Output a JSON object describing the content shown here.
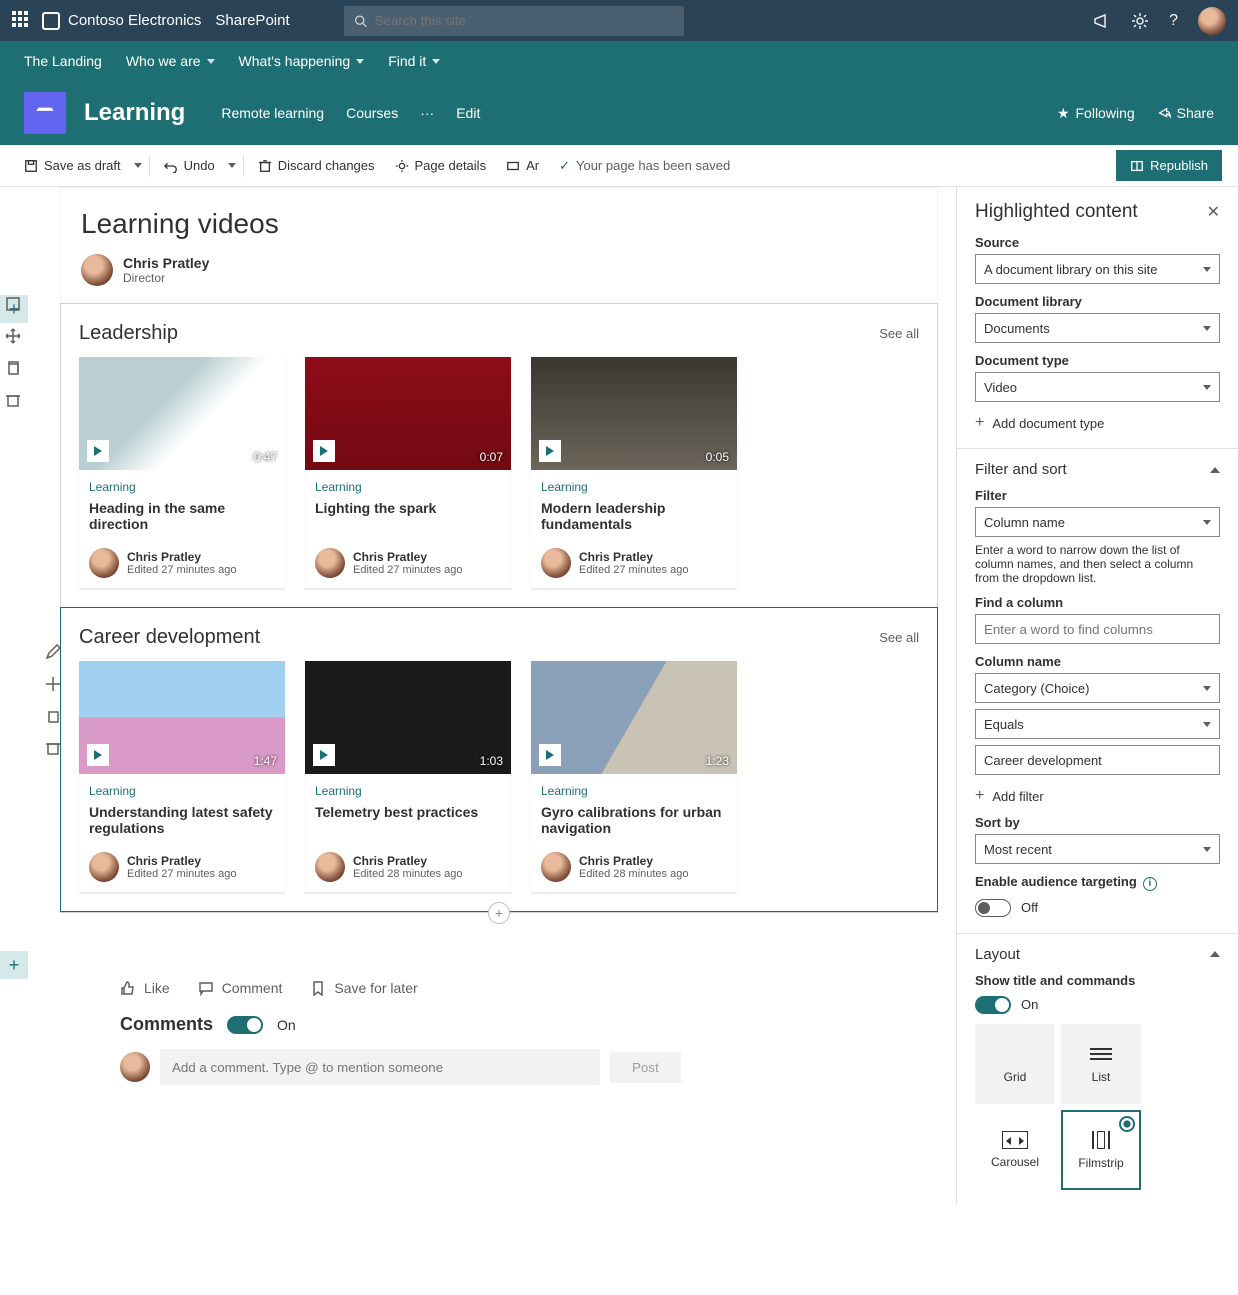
{
  "topbar": {
    "brand": "Contoso Electronics",
    "app": "SharePoint",
    "search_placeholder": "Search this site"
  },
  "sitenav": {
    "items": [
      "The Landing",
      "Who we are",
      "What's happening",
      "Find it"
    ],
    "has_dropdown": [
      false,
      true,
      true,
      true
    ]
  },
  "site": {
    "name": "Learning",
    "tabs": [
      "Remote learning",
      "Courses",
      "···",
      "Edit"
    ],
    "following": "Following",
    "share": "Share"
  },
  "cmdbar": {
    "save": "Save as draft",
    "undo": "Undo",
    "discard": "Discard changes",
    "details": "Page details",
    "ar": "Ar",
    "saved": "Your page has been saved",
    "republish": "Republish"
  },
  "page": {
    "title": "Learning videos",
    "author": "Chris Pratley",
    "role": "Director"
  },
  "sections": [
    {
      "title": "Leadership",
      "seeall": "See all",
      "cards": [
        {
          "duration": "0:47",
          "pill": "Learning",
          "title": "Heading in the same direction",
          "author": "Chris Pratley",
          "edited": "Edited 27 minutes ago",
          "thumbclass": "thumb1"
        },
        {
          "duration": "0:07",
          "pill": "Learning",
          "title": "Lighting the spark",
          "author": "Chris Pratley",
          "edited": "Edited 27 minutes ago",
          "thumbclass": "thumb2"
        },
        {
          "duration": "0:05",
          "pill": "Learning",
          "title": "Modern leadership fundamentals",
          "author": "Chris Pratley",
          "edited": "Edited 27 minutes ago",
          "thumbclass": "thumb3"
        }
      ]
    },
    {
      "title": "Career development",
      "seeall": "See all",
      "cards": [
        {
          "duration": "1:47",
          "pill": "Learning",
          "title": "Understanding latest safety regulations",
          "author": "Chris Pratley",
          "edited": "Edited 27 minutes ago",
          "thumbclass": "thumb4"
        },
        {
          "duration": "1:03",
          "pill": "Learning",
          "title": "Telemetry best practices",
          "author": "Chris Pratley",
          "edited": "Edited 28 minutes ago",
          "thumbclass": "thumb5"
        },
        {
          "duration": "1:23",
          "pill": "Learning",
          "title": "Gyro calibrations for urban navigation",
          "author": "Chris Pratley",
          "edited": "Edited 28 minutes ago",
          "thumbclass": "thumb6"
        }
      ]
    }
  ],
  "social": {
    "like": "Like",
    "comment": "Comment",
    "save": "Save for later"
  },
  "comments": {
    "title": "Comments",
    "state": "On",
    "placeholder": "Add a comment. Type @ to mention someone",
    "post": "Post"
  },
  "panel": {
    "title": "Highlighted content",
    "source_label": "Source",
    "source": "A document library on this site",
    "doclib_label": "Document library",
    "doclib": "Documents",
    "doctype_label": "Document type",
    "doctype": "Video",
    "add_doctype": "Add document type",
    "filtersort": "Filter and sort",
    "filter_label": "Filter",
    "filter": "Column name",
    "filter_help": "Enter a word to narrow down the list of column names, and then select a column from the dropdown list.",
    "findcol_label": "Find a column",
    "findcol_placeholder": "Enter a word to find columns",
    "colname_label": "Column name",
    "colname": "Category (Choice)",
    "operator": "Equals",
    "value": "Career development",
    "add_filter": "Add filter",
    "sortby_label": "Sort by",
    "sortby": "Most recent",
    "audience_label": "Enable audience targeting",
    "audience_state": "Off",
    "layout": "Layout",
    "showtitle_label": "Show title and commands",
    "showtitle_state": "On",
    "layouts": [
      "Grid",
      "List",
      "Carousel",
      "Filmstrip"
    ]
  }
}
